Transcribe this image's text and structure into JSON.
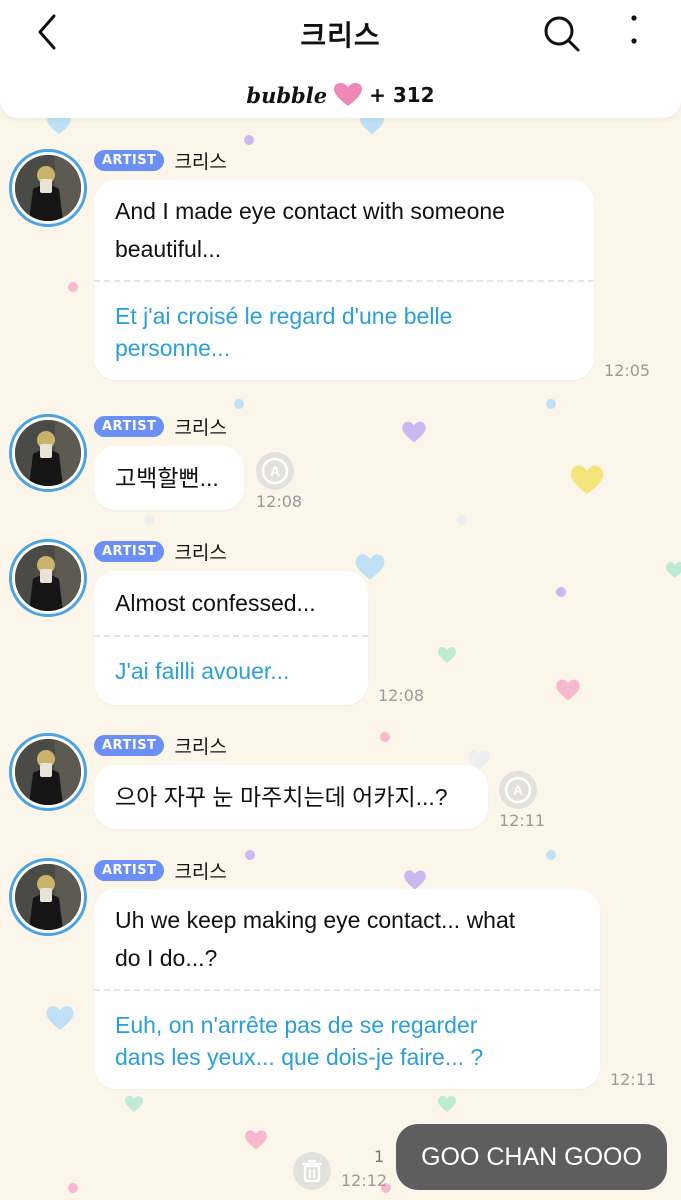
{
  "header": {
    "title": "크리스",
    "back_icon": "chevron-left-icon",
    "search_icon": "search-icon",
    "more_icon": "more-vertical-icon",
    "bubble_logo": "bubble",
    "heart_color": "#f087b8",
    "bubble_count": "+ 312"
  },
  "colors": {
    "background": "#fbf6e9",
    "artist_badge": "#6b8ef7",
    "translation_text": "#2a9fd8",
    "avatar_ring": "#4aa3e2",
    "my_bubble": "#5e5e5e"
  },
  "messages": [
    {
      "badge": "ARTIST",
      "sender": "크리스",
      "text_lines": [
        "And I made eye contact with someone",
        "beautiful..."
      ],
      "translation_lines": [
        "Et j'ai croisé le regard d'une belle",
        "personne..."
      ],
      "time": "12:05"
    },
    {
      "badge": "ARTIST",
      "sender": "크리스",
      "text_lines": [
        "고백할뻔..."
      ],
      "time": "12:08",
      "translate_icon": "translate-icon"
    },
    {
      "badge": "ARTIST",
      "sender": "크리스",
      "text_lines": [
        "Almost confessed..."
      ],
      "translation_lines": [
        "J'ai failli avouer..."
      ],
      "time": "12:08"
    },
    {
      "badge": "ARTIST",
      "sender": "크리스",
      "text_lines": [
        "으아 자꾸 눈 마주치는데 어카지...?"
      ],
      "time": "12:11",
      "translate_icon": "translate-icon"
    },
    {
      "badge": "ARTIST",
      "sender": "크리스",
      "text_lines": [
        "Uh we keep making eye contact... what",
        "do I do...?"
      ],
      "translation_lines": [
        "Euh, on n'arrête pas de se regarder",
        "dans les yeux... que dois-je faire... ?"
      ],
      "time": "12:11"
    }
  ],
  "my_message": {
    "text": "GOO CHAN GOOO",
    "unread_count": "1",
    "time": "12:12",
    "delete_icon": "trash-icon"
  }
}
